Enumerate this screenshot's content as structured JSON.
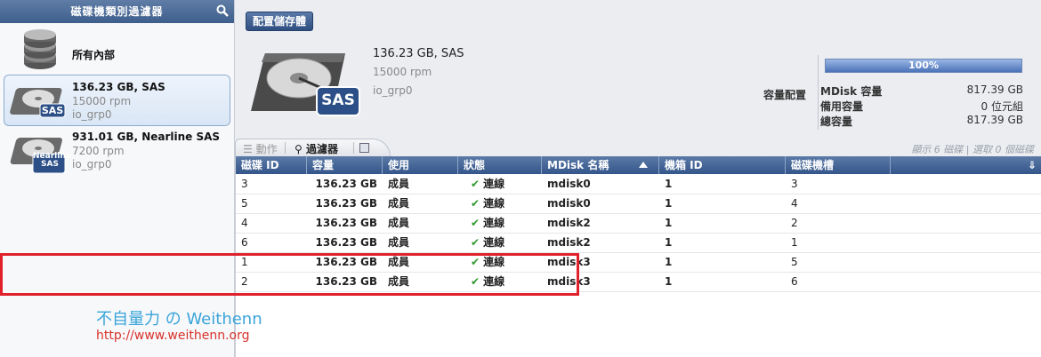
{
  "sidebar": {
    "header": "磁碟機類別過濾器",
    "items": [
      {
        "title": "所有內部",
        "sub1": "",
        "sub2": "",
        "badge": ""
      },
      {
        "title": "136.23 GB, SAS",
        "sub1": "15000 rpm",
        "sub2": "io_grp0",
        "badge": "SAS"
      },
      {
        "title": "931.01 GB, Nearline SAS",
        "sub1": "7200 rpm",
        "sub2": "io_grp0",
        "badge": "Nearline SAS"
      }
    ]
  },
  "header": {
    "config_button": "配置儲存體",
    "summary": {
      "title": "136.23 GB, SAS",
      "rpm": "15000 rpm",
      "group": "io_grp0",
      "badge": "SAS"
    }
  },
  "capacity": {
    "label": "容量配置",
    "percent_text": "100%",
    "percent_value": 100,
    "rows": [
      {
        "key": "MDisk 容量",
        "value": "817.39 GB"
      },
      {
        "key": "備用容量",
        "value": "0 位元組"
      },
      {
        "key": "總容量",
        "value": "817.39 GB"
      }
    ]
  },
  "toolbar": {
    "actions": "動作",
    "filter": "過濾器",
    "status": "顯示 6 磁碟 | 選取 0 個磁碟"
  },
  "table": {
    "columns": [
      "磁碟 ID",
      "容量",
      "使用",
      "狀態",
      "MDisk 名稱",
      "機箱 ID",
      "磁碟機槽"
    ],
    "rows": [
      [
        "3",
        "136.23 GB",
        "成員",
        "連線",
        "mdisk0",
        "1",
        "3"
      ],
      [
        "5",
        "136.23 GB",
        "成員",
        "連線",
        "mdisk0",
        "1",
        "4"
      ],
      [
        "4",
        "136.23 GB",
        "成員",
        "連線",
        "mdisk2",
        "1",
        "2"
      ],
      [
        "6",
        "136.23 GB",
        "成員",
        "連線",
        "mdisk2",
        "1",
        "1"
      ],
      [
        "1",
        "136.23 GB",
        "成員",
        "連線",
        "mdisk3",
        "1",
        "5"
      ],
      [
        "2",
        "136.23 GB",
        "成員",
        "連線",
        "mdisk3",
        "1",
        "6"
      ]
    ]
  },
  "watermark": {
    "brand": "不自量力 の Weithenn",
    "url": "http://www.weithenn.org"
  },
  "colors": {
    "accent": "#3e5e8c",
    "highlight": "#e0212b",
    "status_ok": "#2f9a2f"
  }
}
